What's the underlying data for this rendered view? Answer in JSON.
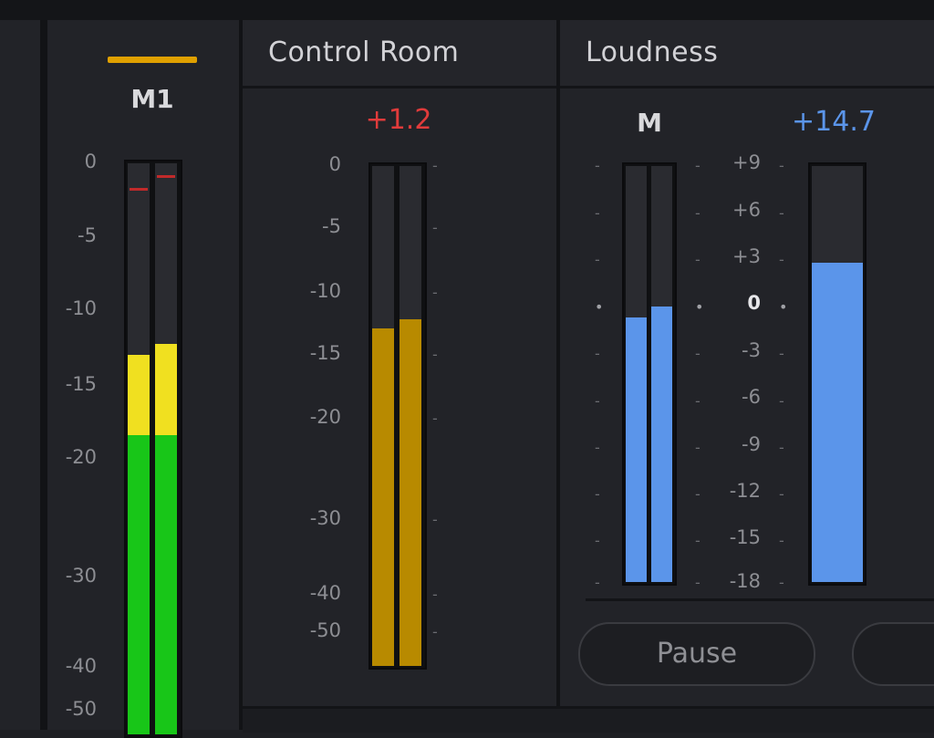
{
  "colors": {
    "m1_indicator": "#e0a000",
    "green": "#18c618",
    "yellow": "#f0e020",
    "amber": "#b88a00",
    "blue": "#5b95ea",
    "peak_red": "#e03b3b",
    "loudness_blue": "#5b95ea"
  },
  "m1": {
    "label": "M1",
    "scale": [
      "0",
      "-5",
      "-10",
      "-15",
      "-20",
      "-30",
      "-40",
      "-50"
    ]
  },
  "control_room": {
    "title": "Control Room",
    "peak_value": "+1.2",
    "scale": [
      "0",
      "-5",
      "-10",
      "-15",
      "-20",
      "-30",
      "-40",
      "-50"
    ]
  },
  "loudness": {
    "title": "Loudness",
    "m_label": "M",
    "value": "+14.7",
    "scale": [
      "+9",
      "+6",
      "+3",
      "0",
      "-3",
      "-6",
      "-9",
      "-12",
      "-15",
      "-18"
    ],
    "pause_label": "Pause"
  }
}
